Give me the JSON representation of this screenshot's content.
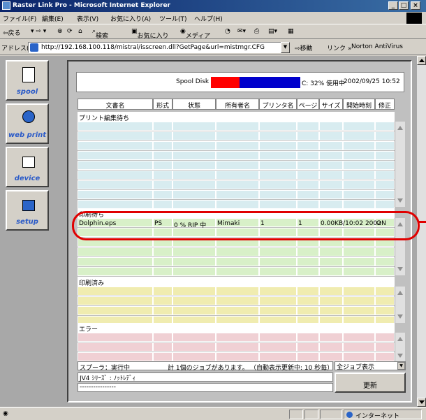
{
  "window": {
    "title": "Raster Link Pro - Microsoft Internet Explorer"
  },
  "menu": [
    "ファイル(F)",
    "編集(E)",
    "表示(V)",
    "お気に入り(A)",
    "ツール(T)",
    "ヘルプ(H)"
  ],
  "toolbar": {
    "back": "⇦戻る",
    "search": "検索",
    "favorites": "お気に入り",
    "media": "メディア"
  },
  "address": {
    "label": "アドレス(D)",
    "url": "http://192.168.100.118/mistral/isscreen.dll?GetPage&url=mistmgr.CFG",
    "go": "移動",
    "links": "リンク »",
    "norton": "Norton AntiVirus"
  },
  "sidebar": [
    {
      "label": "spool"
    },
    {
      "label": "web print"
    },
    {
      "label": "device"
    },
    {
      "label": "setup"
    }
  ],
  "status": {
    "spool_label": "Spool Disk",
    "usage": "C: 32% 使用中",
    "datetime": "2002/09/25 10:52",
    "used_fraction": 0.32
  },
  "columns": [
    "文書名",
    "形式",
    "状態",
    "所有者名",
    "プリンタ名",
    "ページ",
    "サイズ",
    "開始時刻",
    "修正"
  ],
  "sections": [
    {
      "title": "プリント編集待ち",
      "color": "#d8ecf0",
      "rows": []
    },
    {
      "title": "印刷待ち",
      "color": "#d8f0c8",
      "rows": [
        {
          "document": "Dolphin.eps",
          "format": "PS",
          "status": "0 % RIP 中",
          "owner": "Mimaki",
          "printer": "1",
          "pages": "1",
          "size_time": "0.00KB/10:02 2002",
          "modify": "ON"
        }
      ]
    },
    {
      "title": "印刷済み",
      "color": "#f0ecb0",
      "rows": []
    },
    {
      "title": "エラー",
      "color": "#f0d0d4",
      "rows": []
    }
  ],
  "footer": {
    "spooler": "スプーラ：実行中",
    "jobs": "計 1個のジョブがあります。",
    "auto_refresh": "（自動表示更新中: 10 秒毎）",
    "filter": "全ジョブ表示",
    "printer_status": "JV4 ｼﾘｰｽﾞ : ﾉｯﾄﾚﾃﾞｨ",
    "divider": "----------------",
    "refresh_button": "更新"
  },
  "statusbar": {
    "zone": "インターネット"
  },
  "colors": {
    "highlight": "#e00000",
    "bar_red": "#ff0000",
    "bar_blue": "#0000cc"
  }
}
